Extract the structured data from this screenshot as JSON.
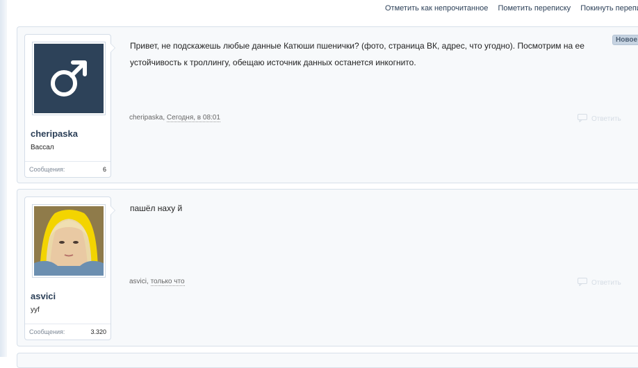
{
  "top_links": [
    {
      "label": "Отметить как непрочитанное"
    },
    {
      "label": "Пометить переписку"
    },
    {
      "label": "Покинуть переписку"
    }
  ],
  "messages": [
    {
      "username": "cheripaska",
      "user_title": "Вассал",
      "stats_label": "Сообщения:",
      "stats_value": "6",
      "avatar_icon": "male-symbol-icon",
      "text": "Привет, не подскажешь любые данные Катюши пшенички? (фото, страница ВК, адрес, что угодно). Посмотрим на ее устойчивость к троллингу, обещаю источник данных останется инкогнито.",
      "meta_author": "cheripaska",
      "meta_separator": ", ",
      "meta_date": "Сегодня, в 08:01",
      "reply_label": "Ответить",
      "badge": "Новое"
    },
    {
      "username": "asvici",
      "user_title": "yyf",
      "stats_label": "Сообщения:",
      "stats_value": "3.320",
      "avatar_icon": "user-photo",
      "text": "пашёл наху й",
      "meta_author": "asvici",
      "meta_separator": ", ",
      "meta_date": "только что",
      "reply_label": "Ответить"
    }
  ],
  "colors": {
    "accent": "#2b3f57",
    "avatar_bg": "#2d4259",
    "panel_bg": "#f7f9fb",
    "border": "#d7e0ea"
  }
}
